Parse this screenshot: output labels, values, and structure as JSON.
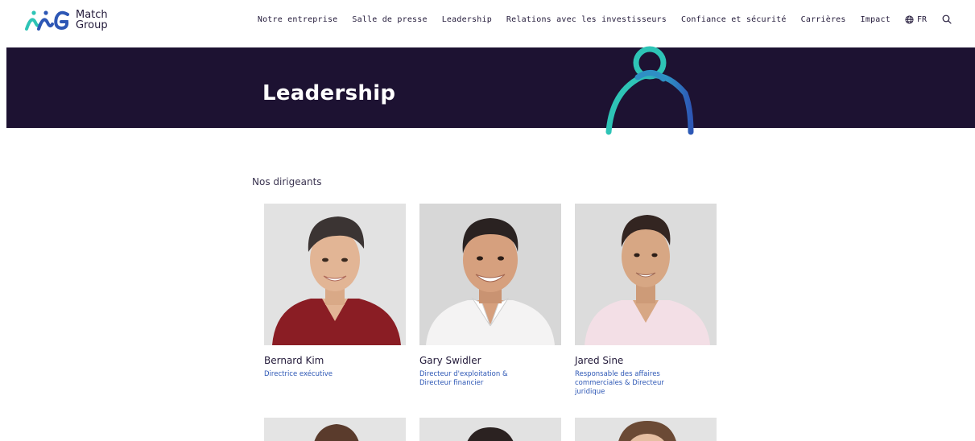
{
  "brand": {
    "name_line1": "Match",
    "name_line2": "Group",
    "colors": {
      "navy": "#1d1232",
      "teal": "#2ec4b6",
      "blue": "#2d57b5",
      "text": "#231a3a"
    }
  },
  "nav": {
    "items": [
      "Notre entreprise",
      "Salle de presse",
      "Leadership",
      "Relations avec les investisseurs",
      "Confiance et sécurité",
      "Carrières",
      "Impact"
    ],
    "language": "FR",
    "icons": {
      "language": "globe-icon",
      "search": "search-icon"
    }
  },
  "hero": {
    "title": "Leadership"
  },
  "section": {
    "label": "Nos dirigeants"
  },
  "leaders": [
    {
      "name": "Bernard Kim",
      "role": "Directrice exécutive",
      "shirt": "#8a1d24",
      "skin": "#e2b595",
      "hair": "#3b3433"
    },
    {
      "name": "Gary Swidler",
      "role": "Directeur d'exploitation & Directeur financier",
      "shirt": "#f4f3f3",
      "skin": "#d6a07e",
      "hair": "#2a2221"
    },
    {
      "name": "Jared Sine",
      "role": "Responsable des affaires commerciales & Directeur juridique",
      "shirt": "#f3dfe6",
      "skin": "#d7a784",
      "hair": "#332521"
    }
  ]
}
